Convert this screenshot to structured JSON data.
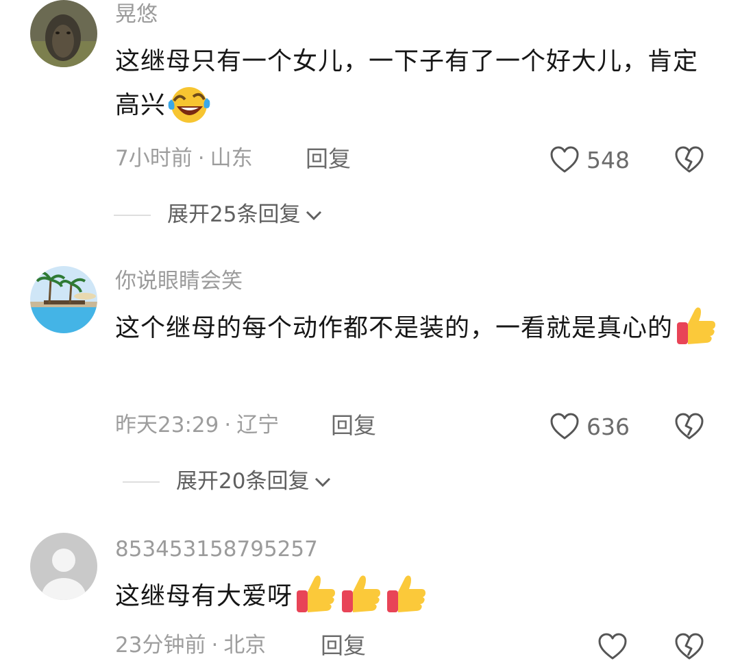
{
  "comments": [
    {
      "username": "晃悠",
      "text": "这继母只有一个女儿，一下子有了一个好大儿，肯定高兴",
      "emojis": [
        "laughing-crying-emoji"
      ],
      "time": "7小时前",
      "dot": "·",
      "location": "山东",
      "reply_label": "回复",
      "likes": "548",
      "expand_label": "展开25条回复"
    },
    {
      "username": "你说眼睛会笑",
      "text": "这个继母的每个动作都不是装的，一看就是真心的",
      "emojis": [
        "thumbs-up-emoji"
      ],
      "time": "昨天23:29",
      "dot": "·",
      "location": "辽宁",
      "reply_label": "回复",
      "likes": "636",
      "expand_label": "展开20条回复"
    },
    {
      "username": "853453158795257",
      "text": "这继母有大爱呀",
      "emojis": [
        "thumbs-up-emoji",
        "thumbs-up-emoji",
        "thumbs-up-emoji"
      ],
      "time": "23分钟前",
      "dot": "·",
      "location": "北京",
      "reply_label": "回复"
    }
  ],
  "colors": {
    "username": "#9b9b9b",
    "text": "#161616",
    "meta": "#9d9d9d",
    "action": "#6b6b6b"
  }
}
